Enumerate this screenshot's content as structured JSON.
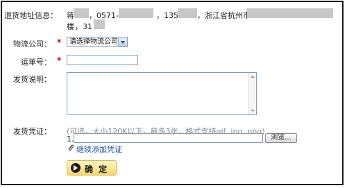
{
  "address": {
    "label": "退货地址信息：",
    "name_part": "蒋",
    "phone_prefix": "，0571-",
    "mobile_prefix": "，135",
    "region": "，浙江省杭州市",
    "line2_start": "楼",
    "postcode_prefix": "，31"
  },
  "company": {
    "label": "物流公司：",
    "required": "*",
    "select_value": "请选择物流公司"
  },
  "waybill": {
    "label": "运单号：",
    "required": "*",
    "value": ""
  },
  "description": {
    "label": "发货说明：",
    "value": ""
  },
  "voucher": {
    "label": "发货凭证：",
    "hint": "(可选，大小120K以下，最多3张，格式支持gif, jpg, png)",
    "item_number": "1.",
    "file_value": "",
    "browse_label": "浏览...",
    "add_more_label": "继续添加凭证"
  },
  "confirm": {
    "label": "确 定"
  },
  "colors": {
    "required": "#d40000",
    "link": "#1c4fa8",
    "confirm_bg": "#f8d669",
    "hint": "#888888"
  },
  "icons": {
    "paperclip": "paperclip-icon",
    "confirm": "arrow-right-circle-icon"
  }
}
